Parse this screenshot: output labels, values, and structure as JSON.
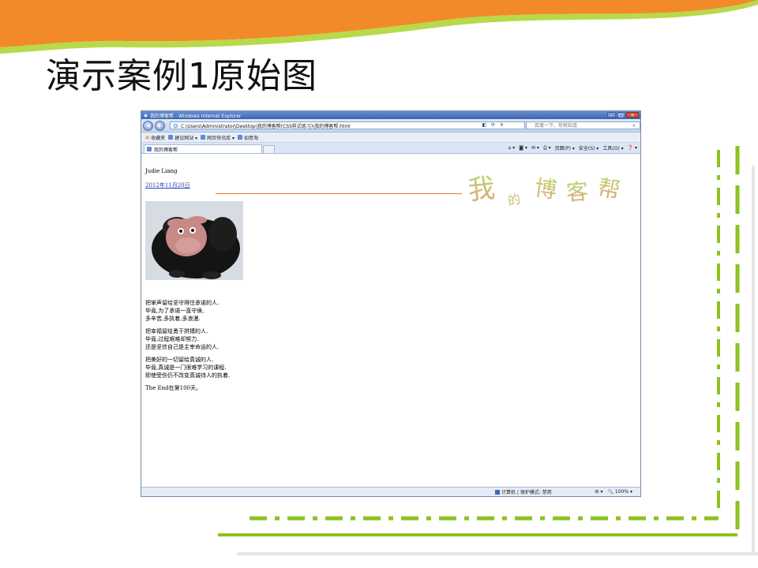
{
  "slide": {
    "title": "演示案例1原始图"
  },
  "window": {
    "title": "我的博客帮 - Windows Internet Explorer",
    "minimize_label": "–",
    "maximize_label": "□",
    "close_label": "✕"
  },
  "address_bar": {
    "url": "C:\\Users\\Administrator\\Desktop\\我的博客帮(CSS样式练习)\\我的博客帮.html",
    "search_placeholder": "百度一下，你就知道"
  },
  "favorites_bar": {
    "favorites_label": "收藏夹",
    "items": [
      "建议网站 ▾",
      "网页快讯库 ▾",
      "如意淘"
    ]
  },
  "tab": {
    "label": "我的博客帮"
  },
  "command_bar": {
    "items": [
      "页面(P) ▾",
      "安全(S) ▾",
      "工具(O) ▾"
    ]
  },
  "page": {
    "author": "Judie Liang",
    "date": "2012年11月20日",
    "logo_chars": [
      "我",
      "的",
      "博",
      "客",
      "帮"
    ],
    "stanzas": [
      [
        "把掌声留给坚守得住承诺的人.",
        "毕竟,为了承诺一直守侯,",
        "多辛苦,多执着,多浪漫."
      ],
      [
        "把幸福留给勇于拼搏的人.",
        "毕竟,过程艰难却努力.",
        "还是坚信自己是主宰命运的人."
      ],
      [
        "把美好的一切留给真诚的人.",
        "毕竟,真诚是一门很难学习的课程.",
        "即使受伤仍不改变真诚待人的执着."
      ]
    ],
    "footer_line": "The End在第100天。"
  },
  "status_bar": {
    "zone": "计算机 | 保护模式: 禁用",
    "zoom": "100%"
  },
  "colors": {
    "wave_orange": "#f28a2a",
    "wave_green": "#8dc21f",
    "divider_orange": "#e57a2c",
    "link_blue": "#2a3fb0"
  }
}
